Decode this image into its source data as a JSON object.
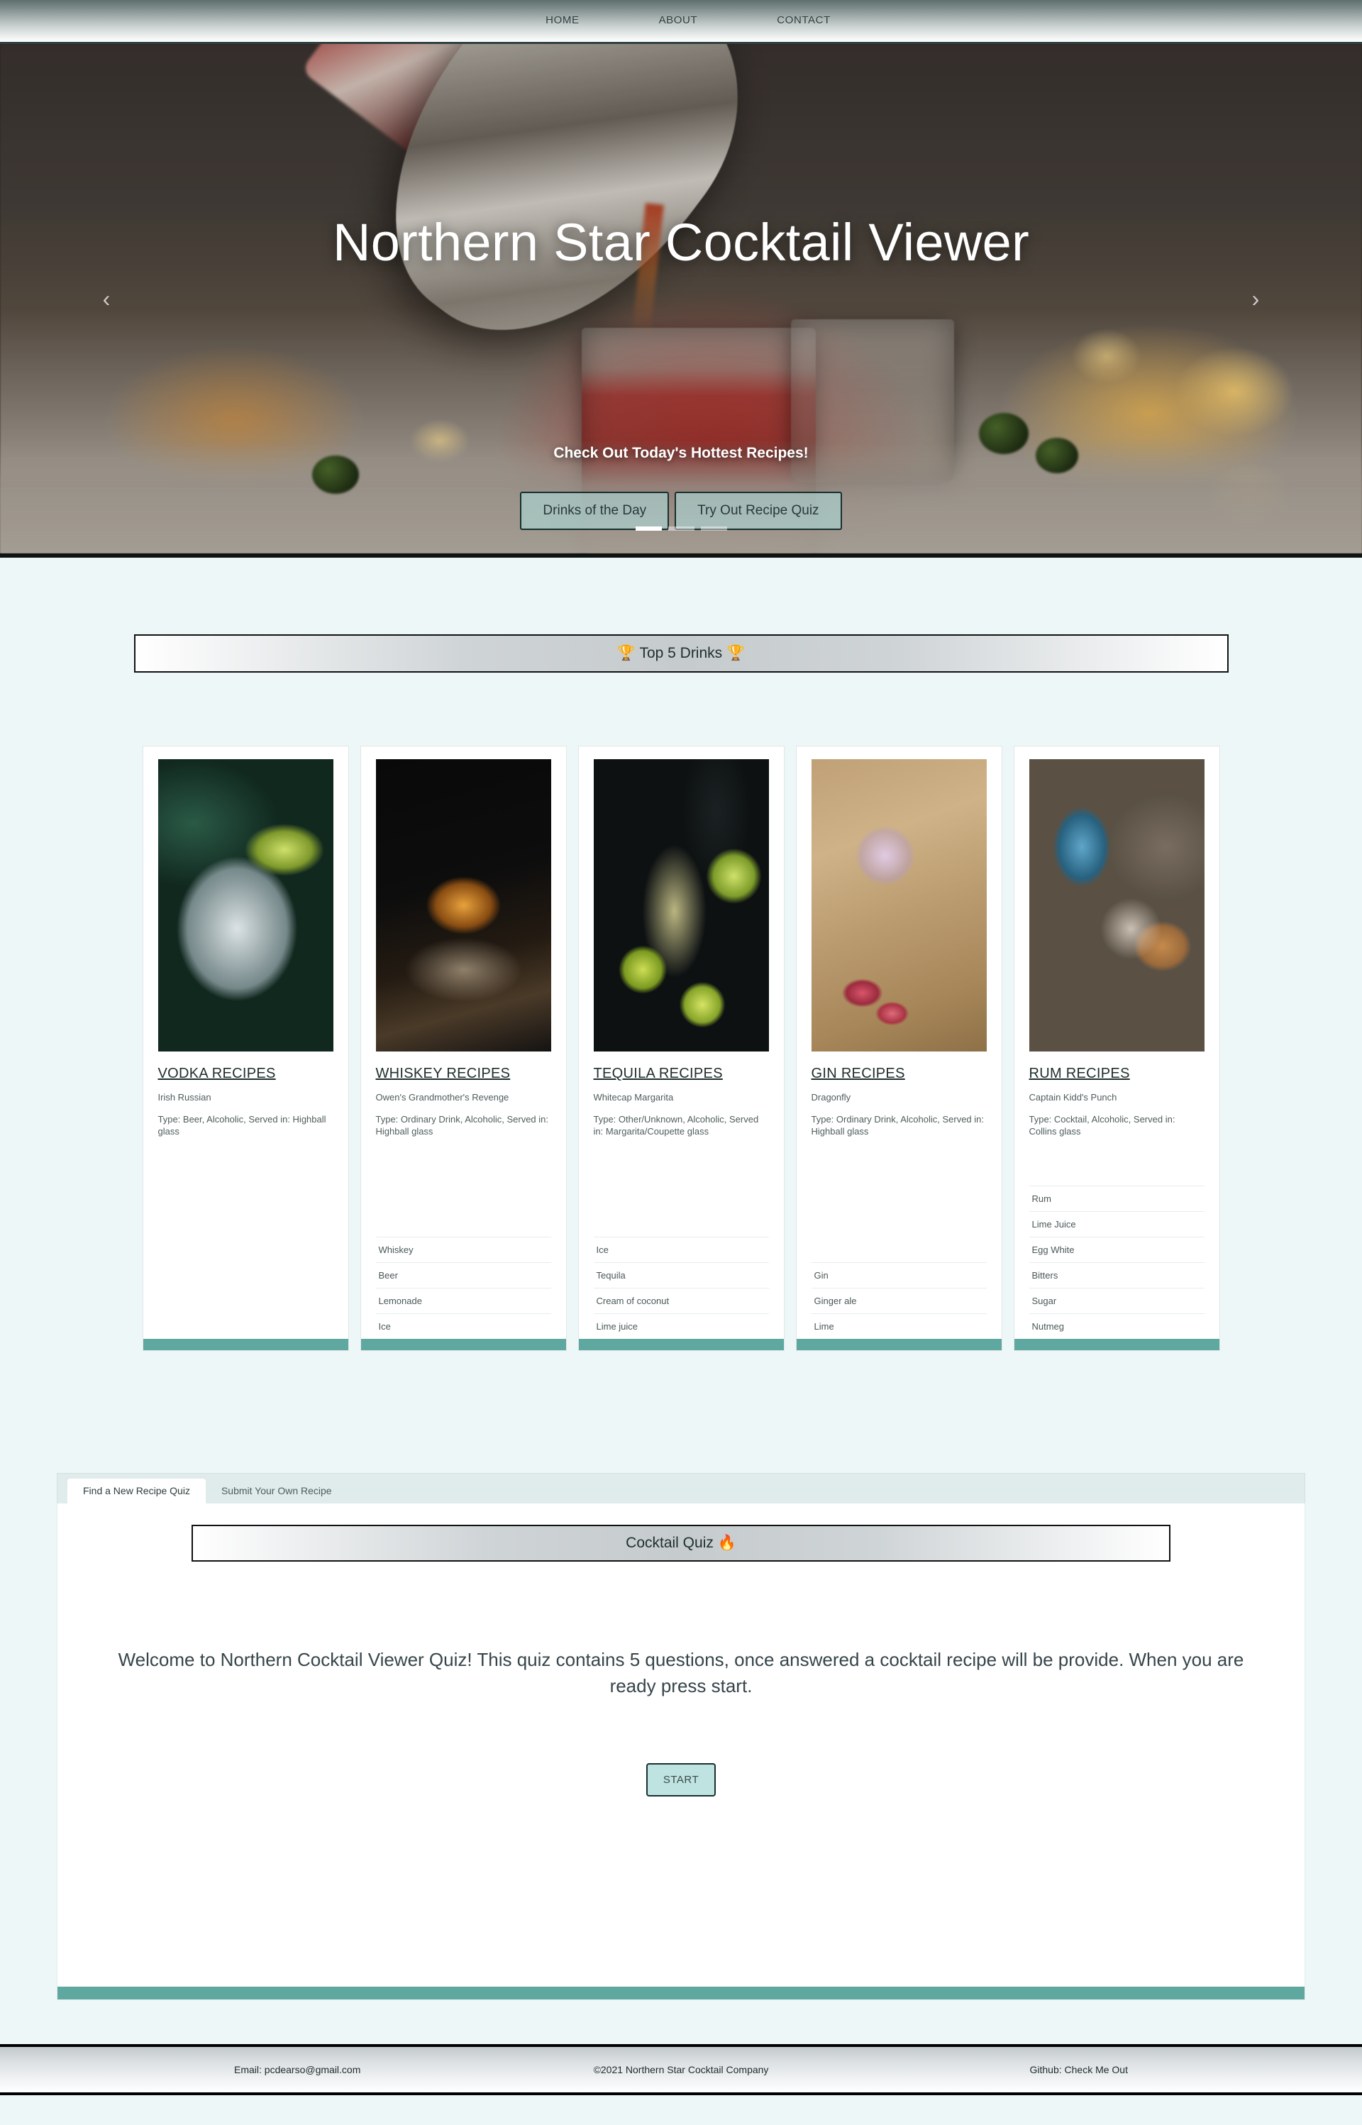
{
  "nav": {
    "links": [
      {
        "label": "HOME"
      },
      {
        "label": "ABOUT"
      },
      {
        "label": "CONTACT"
      }
    ]
  },
  "hero": {
    "title": "Northern Star Cocktail Viewer",
    "caption": "Check Out Today's Hottest Recipes!",
    "buttons": [
      {
        "label": "Drinks of the Day"
      },
      {
        "label": "Try Out Recipe Quiz"
      }
    ],
    "prev_arrow": "‹",
    "next_arrow": "›",
    "indicator_count": 3,
    "active_indicator": 0
  },
  "top5": {
    "header": "🏆 Top 5 Drinks 🏆",
    "cards": [
      {
        "title": "VODKA RECIPES",
        "drink": "Irish Russian",
        "type": "Type: Beer, Alcoholic, Served in: Highball glass",
        "image": "vodka-cocktail-photo",
        "ingredients": []
      },
      {
        "title": "WHISKEY RECIPES",
        "drink": "Owen's Grandmother's Revenge",
        "type": "Type: Ordinary Drink, Alcoholic, Served in: Highball glass",
        "image": "whiskey-cocktail-photo",
        "ingredients": [
          "Whiskey",
          "Beer",
          "Lemonade",
          "Ice"
        ]
      },
      {
        "title": "TEQUILA RECIPES",
        "drink": "Whitecap Margarita",
        "type": "Type: Other/Unknown, Alcoholic, Served in: Margarita/Coupette glass",
        "image": "tequila-cocktail-photo",
        "ingredients": [
          "Ice",
          "Tequila",
          "Cream of coconut",
          "Lime juice"
        ]
      },
      {
        "title": "GIN RECIPES",
        "drink": "Dragonfly",
        "type": "Type: Ordinary Drink, Alcoholic, Served in: Highball glass",
        "image": "gin-cocktail-photo",
        "ingredients": [
          "Gin",
          "Ginger ale",
          "Lime"
        ]
      },
      {
        "title": "RUM RECIPES",
        "drink": "Captain Kidd's Punch",
        "type": "Type: Cocktail, Alcoholic, Served in: Collins glass",
        "image": "rum-cocktail-photo",
        "ingredients": [
          "Rum",
          "Lime Juice",
          "Egg White",
          "Bitters",
          "Sugar",
          "Nutmeg"
        ]
      }
    ]
  },
  "quiz": {
    "tabs": [
      {
        "label": "Find a New Recipe Quiz",
        "active": true
      },
      {
        "label": "Submit Your Own Recipe",
        "active": false
      }
    ],
    "header": "Cocktail Quiz 🔥",
    "welcome": "Welcome to Northern Cocktail Viewer Quiz! This quiz contains 5 questions, once answered a cocktail recipe will be provide. When you are ready press start.",
    "start_label": "START"
  },
  "footer": {
    "email": "Email: pcdearso@gmail.com",
    "copyright": "©2021 Northern Star Cocktail Company",
    "github": "Github: Check Me Out"
  },
  "colors": {
    "accent_teal": "#5fa8a0",
    "button_teal": "#bfe3e0",
    "page_bg": "#eef7f7",
    "dark_border": "#17302f"
  }
}
